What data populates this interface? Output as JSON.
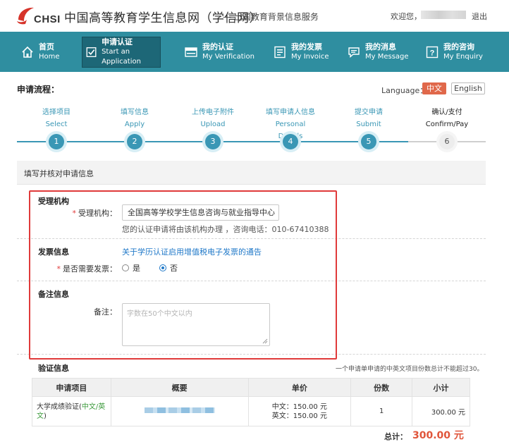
{
  "header": {
    "logo_text": "CHSI",
    "site_title": "中国高等教育学生信息网（学信网）",
    "site_subtitle": "— 出国教育背景信息服务",
    "welcome": "欢迎您，",
    "logout": "退出"
  },
  "nav": {
    "items": [
      {
        "cn": "首页",
        "en": "Home",
        "icon": "home-icon"
      },
      {
        "cn": "申请认证",
        "en": "Start an Application",
        "icon": "checkbox-icon"
      },
      {
        "cn": "我的认证",
        "en": "My Verification",
        "icon": "verification-card-icon"
      },
      {
        "cn": "我的发票",
        "en": "My Invoice",
        "icon": "invoice-icon"
      },
      {
        "cn": "我的消息",
        "en": "My Message",
        "icon": "message-icon"
      },
      {
        "cn": "我的咨询",
        "en": "My Enquiry",
        "icon": "question-icon"
      }
    ]
  },
  "process": {
    "label": "申请流程：",
    "language_label": "Language：",
    "lang_cn": "中文",
    "lang_en": "English",
    "steps": [
      {
        "cn": "选择项目",
        "en": "Select",
        "num": "1"
      },
      {
        "cn": "填写信息",
        "en": "Apply",
        "num": "2"
      },
      {
        "cn": "上传电子附件",
        "en": "Upload",
        "num": "3"
      },
      {
        "cn": "填写申请人信息",
        "en": "Personal Details",
        "num": "4"
      },
      {
        "cn": "提交申请",
        "en": "Submit",
        "num": "5"
      },
      {
        "cn": "确认/支付",
        "en": "Confirm/Pay",
        "num": "6"
      }
    ]
  },
  "form": {
    "section_title": "填写并核对申请信息",
    "agency_title": "受理机构",
    "agency_label": "受理机构：",
    "agency_value": "全国高等学校学生信息咨询与就业指导中心",
    "agency_hint": "您的认证申请将由该机构办理 ，咨询电话：010-67410388",
    "invoice_title": "发票信息",
    "invoice_link": "关于学历认证启用增值税电子发票的通告",
    "invoice_label": "是否需要发票：",
    "invoice_yes": "是",
    "invoice_no": "否",
    "remark_title": "备注信息",
    "remark_label": "备注：",
    "remark_placeholder": "字数在50个中文以内",
    "required_mark": "*"
  },
  "verification": {
    "title": "验证信息",
    "note": "一个申请单申请的中英文项目份数总计不能超过30。",
    "columns": [
      "申请项目",
      "概要",
      "单价",
      "份数",
      "小计"
    ],
    "rows": [
      {
        "item_prefix": "大学成绩验证(",
        "item_green": "中文/英文",
        "item_suffix": ")",
        "price_cn": "中文：150.00 元",
        "price_en": "英文：150.00 元",
        "qty": "1",
        "subtotal": "300.00 元"
      }
    ],
    "total_label": "总计：",
    "total_value": "300.00 元"
  },
  "colors": {
    "nav_bg": "#2f8ea0",
    "nav_active": "#1d6777",
    "step_blue": "#3a97b5",
    "lang_active": "#e0684a",
    "highlight_frame": "#e03a3a",
    "total_red": "#e0553a"
  }
}
